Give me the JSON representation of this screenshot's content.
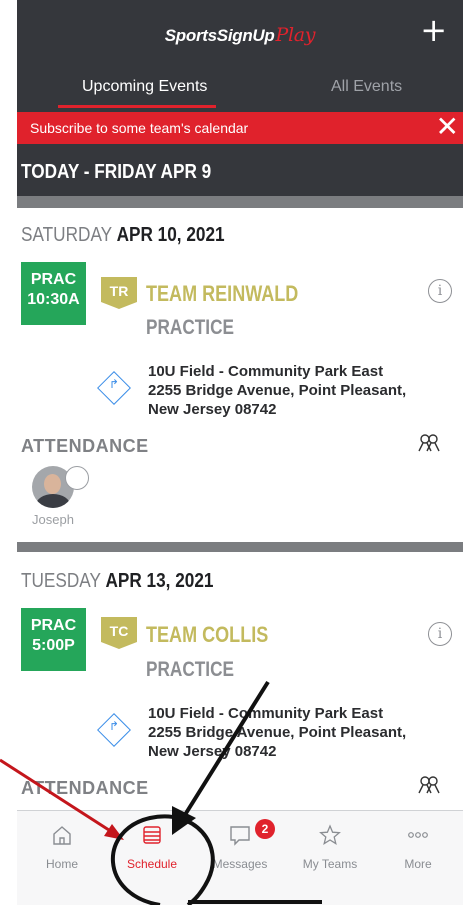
{
  "header": {
    "brand_main": "SportsSignUp",
    "brand_play": "Play",
    "add_icon": "plus-icon"
  },
  "tabs": [
    {
      "label": "Upcoming Events",
      "active": true
    },
    {
      "label": "All Events",
      "active": false
    }
  ],
  "banner": {
    "text": "Subscribe to some team's calendar",
    "close_icon": "close-icon",
    "color": "#e0222c"
  },
  "today_header": "TODAY - FRIDAY APR 9",
  "events": [
    {
      "day_of_week": "SATURDAY",
      "date": "APR 10, 2021",
      "badge_type": "PRAC",
      "badge_time": "10:30A",
      "team_abbr": "TR",
      "team_name": "TEAM REINWALD",
      "event_type": "PRACTICE",
      "address_line1": "10U Field - Community Park East",
      "address_line2": "2255 Bridge Avenue, Point Pleasant,",
      "address_line3": "New Jersey 08742",
      "attendance_label": "ATTENDANCE",
      "attendees": [
        {
          "name": "Joseph"
        }
      ]
    },
    {
      "day_of_week": "TUESDAY",
      "date": "APR 13, 2021",
      "badge_type": "PRAC",
      "badge_time": "5:00P",
      "team_abbr": "TC",
      "team_name": "TEAM COLLIS",
      "event_type": "PRACTICE",
      "address_line1": "10U Field - Community Park East",
      "address_line2": "2255 Bridge Avenue, Point Pleasant,",
      "address_line3": "New Jersey 08742",
      "attendance_label": "ATTENDANCE"
    }
  ],
  "tabbar": {
    "items": [
      {
        "label": "Home",
        "icon": "home-icon"
      },
      {
        "label": "Schedule",
        "icon": "schedule-icon",
        "selected": true
      },
      {
        "label": "Messages",
        "icon": "messages-icon",
        "badge": "2"
      },
      {
        "label": "My Teams",
        "icon": "star-icon"
      },
      {
        "label": "More",
        "icon": "more-icon"
      }
    ]
  },
  "colors": {
    "header_bg": "#35373c",
    "accent_red": "#e0222c",
    "practice_green": "#25a65a",
    "team_gold": "#c3ba5e"
  }
}
